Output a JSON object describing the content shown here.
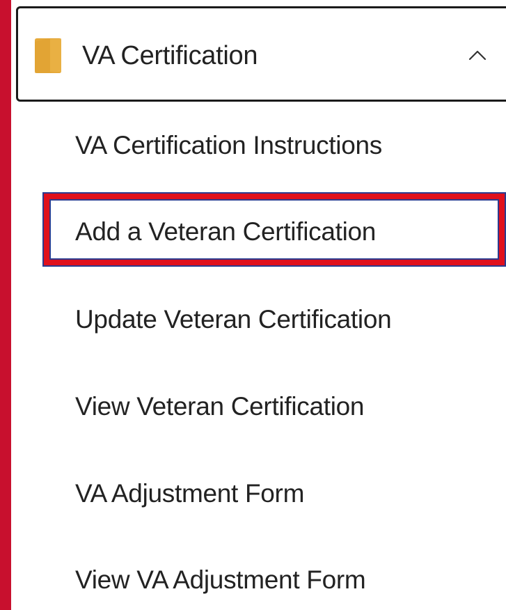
{
  "colors": {
    "stripe": "#c8102e",
    "highlight": "#e0101c",
    "highlight_border": "#2a3b8f",
    "folder": "#e6a93a",
    "text": "#222222"
  },
  "accordion": {
    "title": "VA Certification",
    "icon": "folder-icon",
    "toggle_icon": "chevron-up-icon",
    "expanded": true
  },
  "menu": {
    "items": [
      {
        "label": "VA Certification Instructions",
        "highlighted": false
      },
      {
        "label": "Add a Veteran Certification",
        "highlighted": true
      },
      {
        "label": "Update Veteran Certification",
        "highlighted": false
      },
      {
        "label": "View Veteran Certification",
        "highlighted": false
      },
      {
        "label": "VA Adjustment Form",
        "highlighted": false
      },
      {
        "label": "View VA Adjustment Form",
        "highlighted": false
      }
    ]
  }
}
